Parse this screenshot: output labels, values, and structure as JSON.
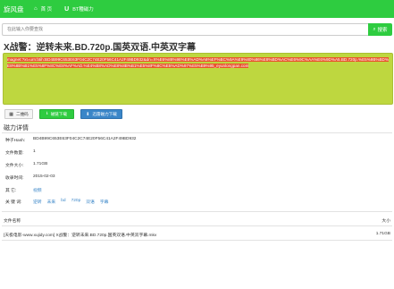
{
  "nav": {
    "brand": "旋风盘",
    "items": [
      {
        "icon": "home-icon",
        "glyph": "⌂",
        "label": "首 页"
      },
      {
        "icon": "u-icon",
        "glyph": "U",
        "label": "BT種磁力"
      }
    ]
  },
  "search": {
    "placeholder": "在此输入你要查找",
    "button_label": "搜索",
    "button_icon": "⌕"
  },
  "title": "X战警：逆转未来.BD.720p.国英双语.中英双字幕",
  "magnet": "magnet:?xt=urn:btih:BD4B99C653E63F04C2C74E20F56C41A2F49BD932&dn=X%E6%88%98%E8%AD%A6%EF%BC%9A%E9%80%86%E8%BD%AC%E6%9C%AA%E6%9D%A5.BD.720p.%E5%9B%BD%E8%8B%B1%E5%8F%8C%E8%AF%AD.%E4%B8%AD%E8%8B%B1%E5%8F%8C%E5%AD%97%E5%B9%95_eyunlongpan.com",
  "buttons": {
    "qr": {
      "glyph": "▦",
      "label": "二维码"
    },
    "download": {
      "glyph": "⭳",
      "label": "磁链下载"
    },
    "thunder": {
      "glyph": "⬇",
      "label": "迅雷磁力下载"
    }
  },
  "details": {
    "section_title": "磁力详情",
    "rows": [
      {
        "label": "种子Hash:",
        "value": "BD4B99C653E63F04C2C74E20F56C41A2F49BD932"
      },
      {
        "label": "文件数量:",
        "value": "1"
      },
      {
        "label": "文件大小:",
        "value": "1.71GB"
      },
      {
        "label": "收录时间:",
        "value": "2015-02-03"
      },
      {
        "label": "其  它:",
        "value": "视频"
      }
    ],
    "keywords_label": "关 键 词:",
    "keywords": [
      "逆转",
      "未来",
      "bd",
      "720p",
      "双语",
      "字幕"
    ]
  },
  "files": {
    "header_name": "文件名称",
    "header_size": "大小",
    "rows": [
      {
        "name": "[天极电影-www.xujidy.com] X战警：逆转未来.BD.720p.国英双语.中英双字幕.mkv",
        "size": "1.71GB"
      }
    ]
  }
}
